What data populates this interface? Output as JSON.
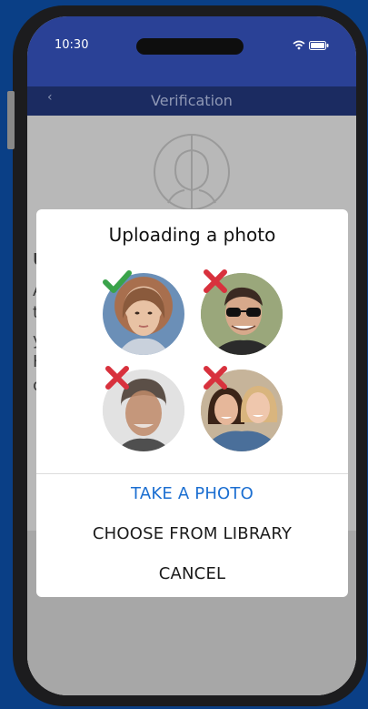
{
  "status": {
    "time": "10:30"
  },
  "nav": {
    "title": "Verification",
    "back_icon": "chevron-left-icon"
  },
  "background": {
    "lines": [
      "U",
      "A",
      "t",
      "y",
      "H",
      "c"
    ]
  },
  "modal": {
    "title": "Uploading a photo",
    "examples": [
      {
        "status": "accepted",
        "icon": "checkmark-icon"
      },
      {
        "status": "rejected",
        "icon": "cross-icon"
      },
      {
        "status": "rejected",
        "icon": "cross-icon"
      },
      {
        "status": "rejected",
        "icon": "cross-icon"
      }
    ],
    "actions": {
      "take_photo": "TAKE A PHOTO",
      "choose_library": "CHOOSE FROM LIBRARY",
      "cancel": "CANCEL"
    }
  },
  "colors": {
    "accent": "#1c6fd1",
    "header": "#2a4196",
    "navbar": "#1b2b61",
    "accepted": "#3aa34a",
    "rejected": "#d8313d"
  }
}
